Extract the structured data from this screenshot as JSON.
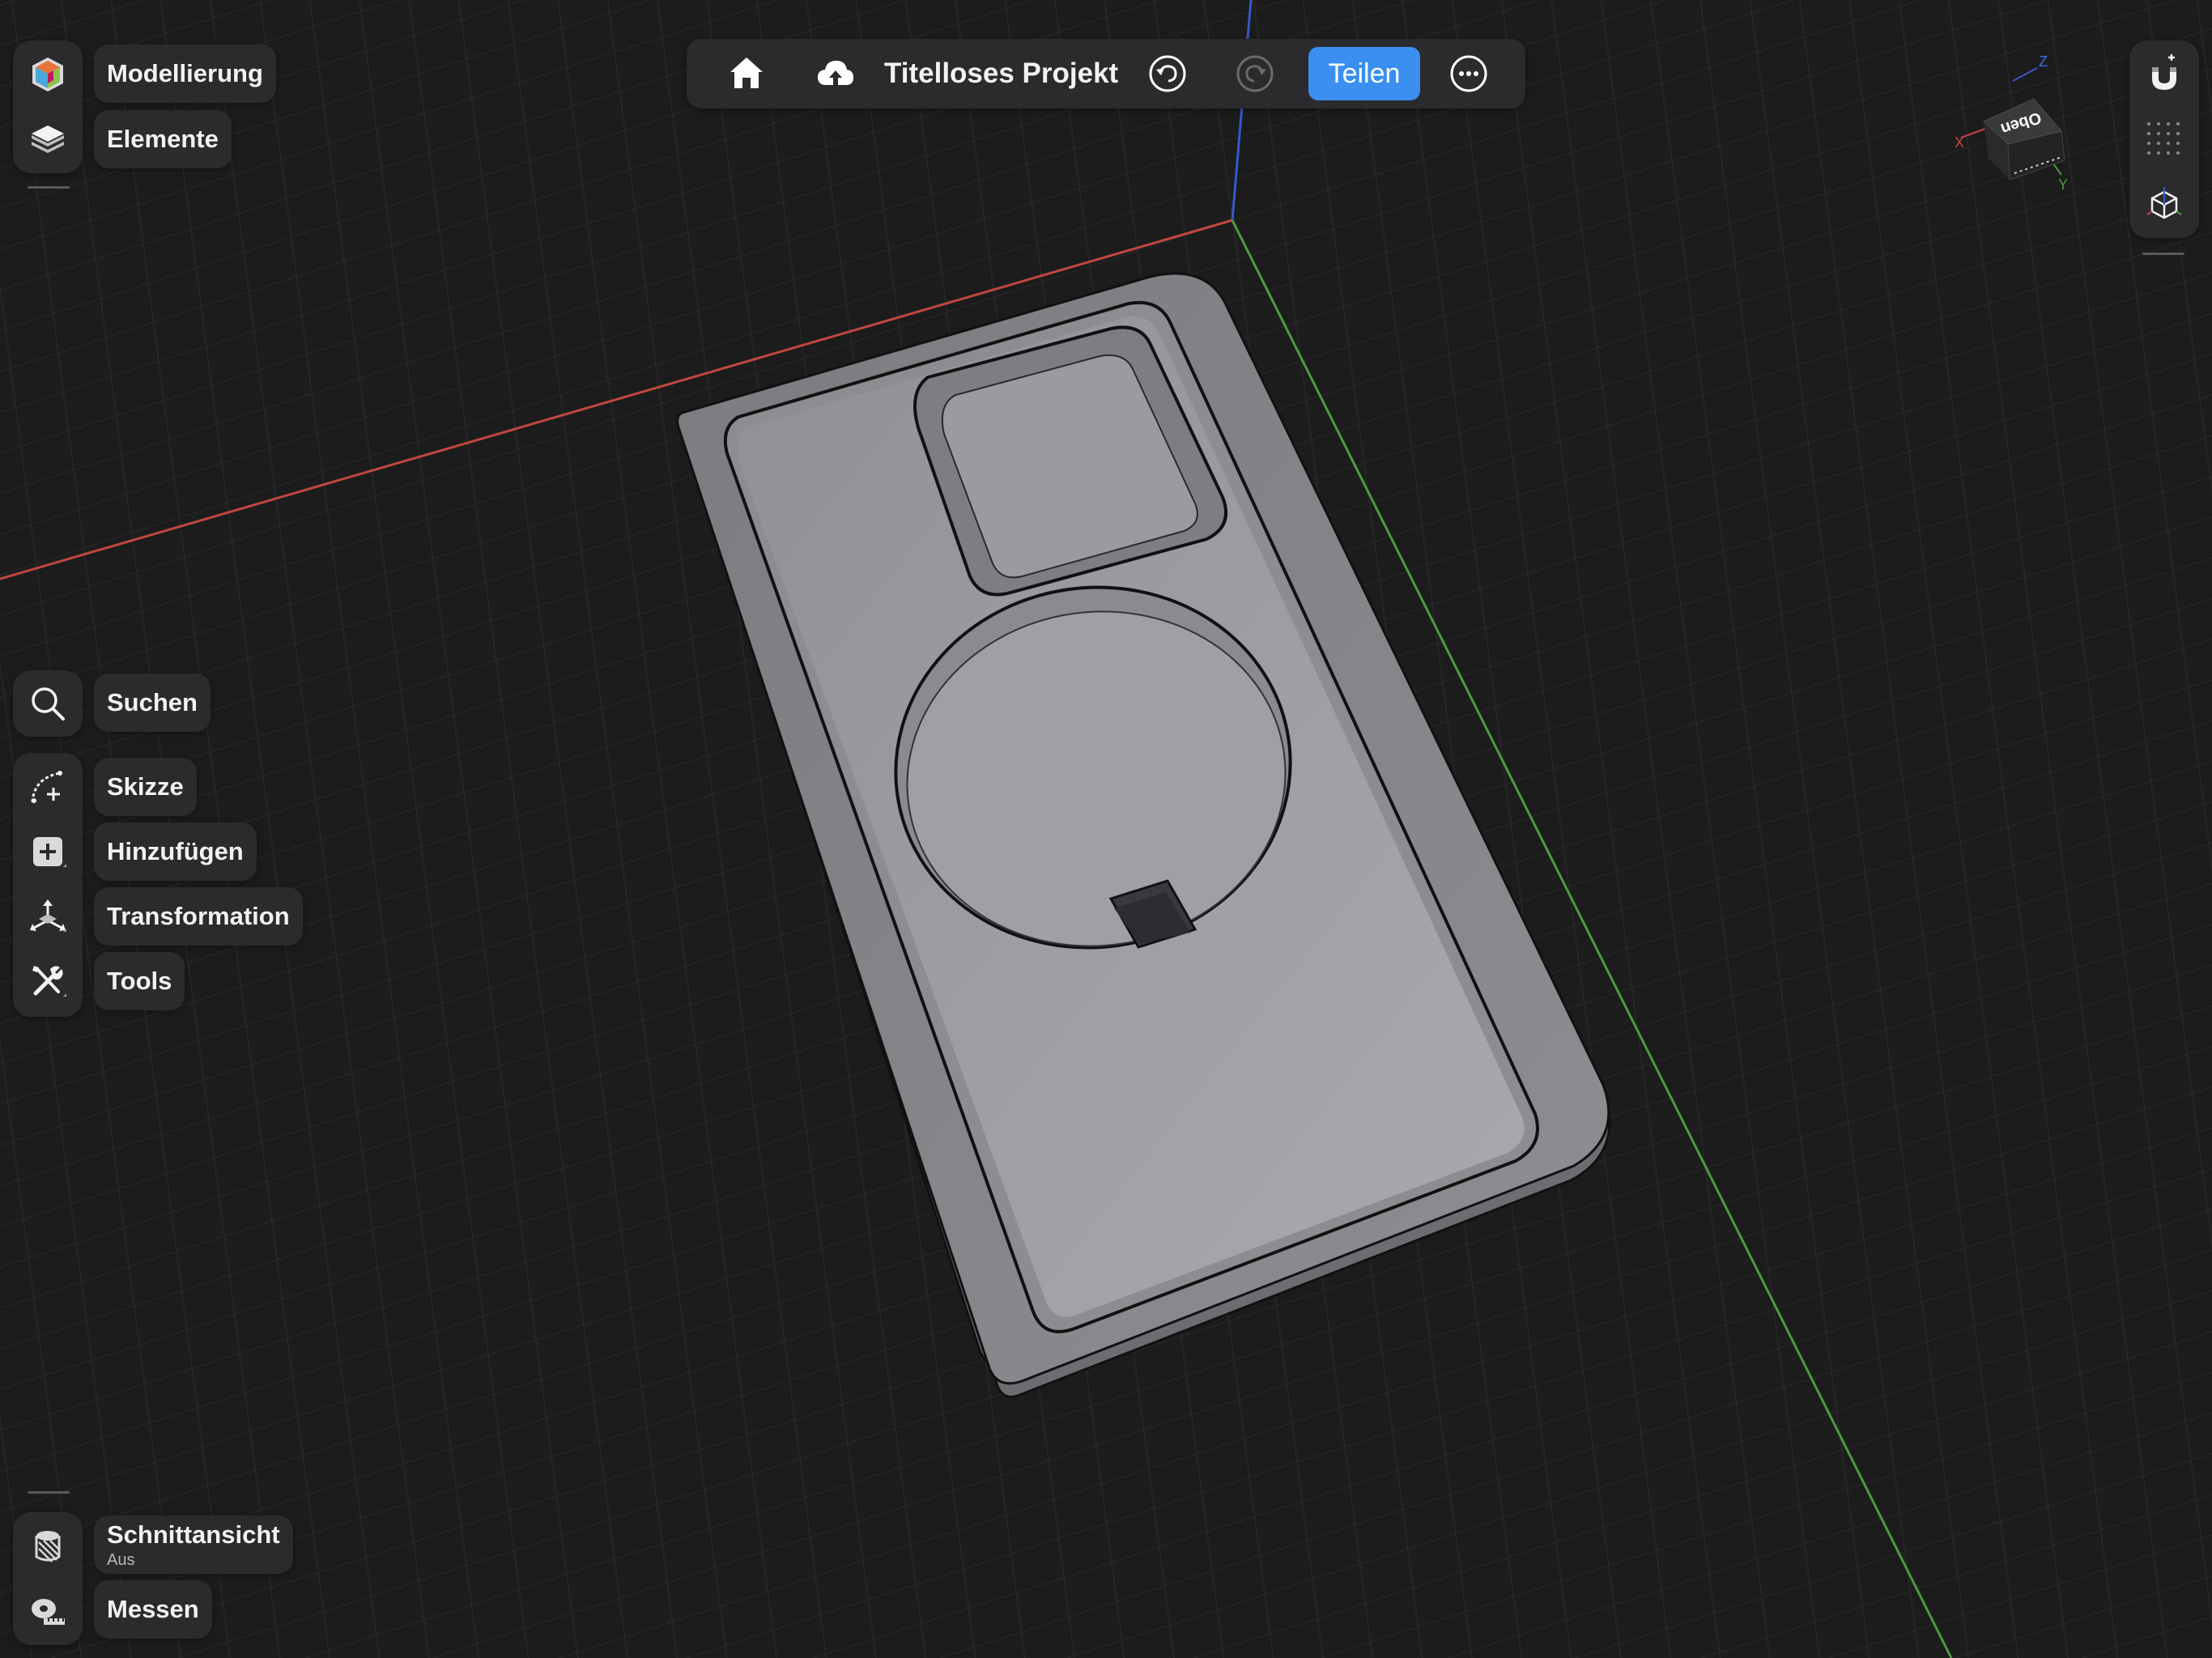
{
  "app": {
    "project_title": "Titelloses Projekt",
    "share_label": "Teilen"
  },
  "left_toolbar": {
    "top_group": [
      {
        "id": "modeling",
        "label": "Modellierung",
        "icon": "modeling-cube-icon"
      },
      {
        "id": "elements",
        "label": "Elemente",
        "icon": "layers-icon"
      }
    ],
    "search": {
      "label": "Suchen",
      "icon": "search-icon"
    },
    "tools_group": [
      {
        "id": "sketch",
        "label": "Skizze",
        "icon": "sketch-curve-icon"
      },
      {
        "id": "add",
        "label": "Hinzufügen",
        "icon": "add-box-icon"
      },
      {
        "id": "transform",
        "label": "Transformation",
        "icon": "transform-arrows-icon"
      },
      {
        "id": "tools",
        "label": "Tools",
        "icon": "wrench-screwdriver-icon"
      }
    ],
    "bottom_group": [
      {
        "id": "section",
        "label": "Schnittansicht",
        "sublabel": "Aus",
        "icon": "section-view-icon"
      },
      {
        "id": "measure",
        "label": "Messen",
        "icon": "tape-measure-icon"
      }
    ]
  },
  "view_cube": {
    "face_label": "Oben",
    "axis_x": "X",
    "axis_y": "Y",
    "axis_z": "Z"
  },
  "right_toolbar": [
    {
      "id": "snap",
      "icon": "magnet-icon"
    },
    {
      "id": "grid",
      "icon": "grid-dots-icon"
    },
    {
      "id": "view-mode",
      "icon": "view-cube-icon"
    }
  ],
  "colors": {
    "background": "#1c1c1d",
    "panel": "#2b2b2d",
    "accent": "#3a8ff0",
    "axis_x": "#c0473f",
    "axis_y": "#4c9a3f",
    "axis_z": "#3559c8",
    "model_face": "#a0a1a6"
  }
}
